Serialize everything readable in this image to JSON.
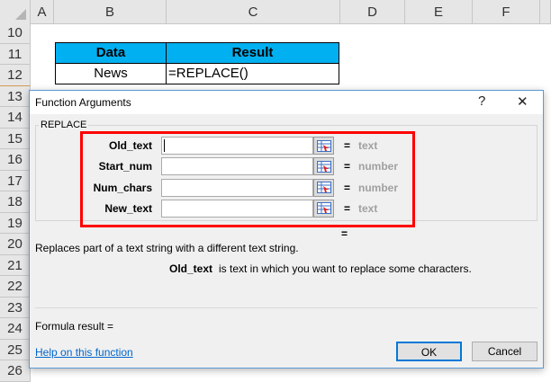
{
  "sheet": {
    "columns": [
      "A",
      "B",
      "C",
      "D",
      "E",
      "F"
    ],
    "rows": [
      "10",
      "11",
      "12",
      "13",
      "14",
      "15",
      "16",
      "17",
      "18",
      "19",
      "20",
      "21",
      "22",
      "23",
      "24",
      "25",
      "26"
    ],
    "table": {
      "headers": [
        "Data",
        "Result"
      ],
      "row": [
        "News",
        "=REPLACE()"
      ],
      "header_color": "#00b0f0"
    }
  },
  "dialog": {
    "title": "Function Arguments",
    "help_glyph": "?",
    "close_glyph": "✕",
    "function_name": "REPLACE",
    "args": [
      {
        "label": "Old_text",
        "value": "",
        "type": "text"
      },
      {
        "label": "Start_num",
        "value": "",
        "type": "number"
      },
      {
        "label": "Num_chars",
        "value": "",
        "type": "number"
      },
      {
        "label": "New_text",
        "value": "",
        "type": "text"
      }
    ],
    "eq": "=",
    "result_eq": "=",
    "description": "Replaces part of a text string with a different text string.",
    "arg_help_name": "Old_text",
    "arg_help_text": "is text in which you want to replace some characters.",
    "formula_result": "Formula result =",
    "help_link": "Help on this function",
    "ok": "OK",
    "cancel": "Cancel",
    "highlight_color": "#ff0000"
  }
}
